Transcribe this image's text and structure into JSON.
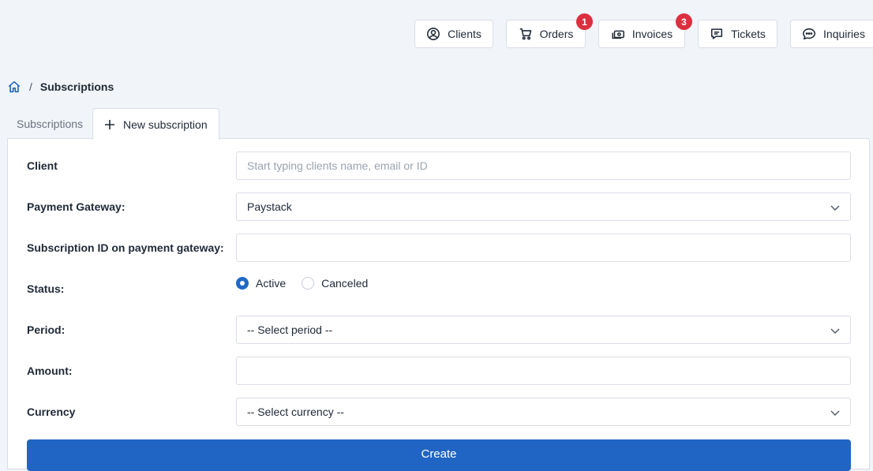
{
  "topnav": {
    "clients": "Clients",
    "orders": "Orders",
    "orders_badge": "1",
    "invoices": "Invoices",
    "invoices_badge": "3",
    "tickets": "Tickets",
    "inquiries": "Inquiries"
  },
  "breadcrumb": {
    "home_icon": "home-icon",
    "separator": "/",
    "current": "Subscriptions"
  },
  "tabs": [
    {
      "label": "Subscriptions",
      "active": false
    },
    {
      "label": "New subscription",
      "active": true,
      "icon": "plus-icon"
    }
  ],
  "form": {
    "client": {
      "label": "Client",
      "placeholder": "Start typing clients name, email or ID",
      "value": ""
    },
    "gateway": {
      "label": "Payment Gateway:",
      "value": "Paystack"
    },
    "sub_id": {
      "label": "Subscription ID on payment gateway:",
      "value": ""
    },
    "status": {
      "label": "Status:",
      "options": [
        "Active",
        "Canceled"
      ],
      "selected": "Active"
    },
    "period": {
      "label": "Period:",
      "value": "-- Select period --"
    },
    "amount": {
      "label": "Amount:",
      "value": ""
    },
    "currency": {
      "label": "Currency",
      "value": "-- Select currency --"
    },
    "submit_label": "Create"
  },
  "colors": {
    "accent": "#2065c4",
    "badge": "#dc2f3f",
    "background": "#f1f4f8"
  }
}
